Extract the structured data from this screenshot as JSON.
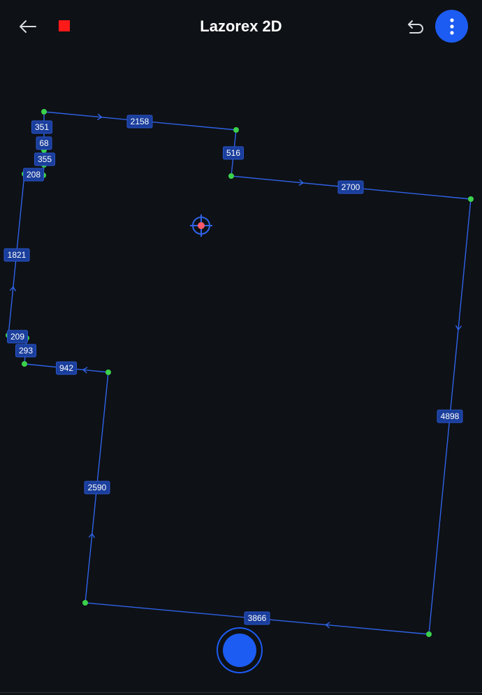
{
  "header": {
    "title": "Lazorex 2D",
    "back_icon": "arrow-left-icon",
    "stop_icon": "stop-square-icon",
    "undo_icon": "undo-icon",
    "menu_icon": "more-vertical-icon"
  },
  "colors": {
    "background": "#0e1116",
    "accent": "#1d5cf2",
    "line": "#2f63e8",
    "vertex": "#3bd14b",
    "label_bg": "#1a3e9c",
    "stop": "#ff1a1a",
    "target": "#ff5a6a"
  },
  "measurements": [
    {
      "id": "m1",
      "length": "2158"
    },
    {
      "id": "m2",
      "length": "516"
    },
    {
      "id": "m3",
      "length": "2700"
    },
    {
      "id": "m4",
      "length": "4898"
    },
    {
      "id": "m5",
      "length": "3866"
    },
    {
      "id": "m6",
      "length": "2590"
    },
    {
      "id": "m7",
      "length": "942"
    },
    {
      "id": "m8",
      "length": "293"
    },
    {
      "id": "m9",
      "length": "209"
    },
    {
      "id": "m10",
      "length": "1821"
    },
    {
      "id": "m11",
      "length": "208"
    },
    {
      "id": "m12",
      "length": "355"
    },
    {
      "id": "m13",
      "length": "68"
    },
    {
      "id": "m14",
      "length": "351"
    }
  ],
  "target_icon": "crosshair-target-icon",
  "capture_icon": "capture-record-icon"
}
